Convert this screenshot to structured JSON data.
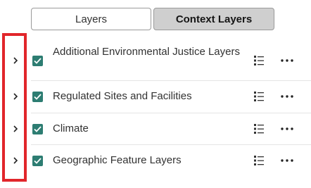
{
  "tabs": [
    {
      "label": "Layers",
      "selected": false
    },
    {
      "label": "Context Layers",
      "selected": true
    }
  ],
  "layers": [
    {
      "label": "Additional Environmental Justice Layers",
      "checked": true,
      "expand_icon": "chevron-right-icon",
      "legend_icon": "legend-list-icon",
      "menu_icon": "more-options-icon"
    },
    {
      "label": "Regulated Sites and Facilities",
      "checked": true,
      "expand_icon": "chevron-right-icon",
      "legend_icon": "legend-list-icon",
      "menu_icon": "more-options-icon"
    },
    {
      "label": "Climate",
      "checked": true,
      "expand_icon": "chevron-right-icon",
      "legend_icon": "legend-list-icon",
      "menu_icon": "more-options-icon"
    },
    {
      "label": "Geographic Feature Layers",
      "checked": true,
      "expand_icon": "chevron-right-icon",
      "legend_icon": "legend-list-icon",
      "menu_icon": "more-options-icon"
    }
  ],
  "colors": {
    "checkbox": "#2d7d72",
    "highlight_box": "#e1262b",
    "selected_tab": "#cfcfcf"
  }
}
